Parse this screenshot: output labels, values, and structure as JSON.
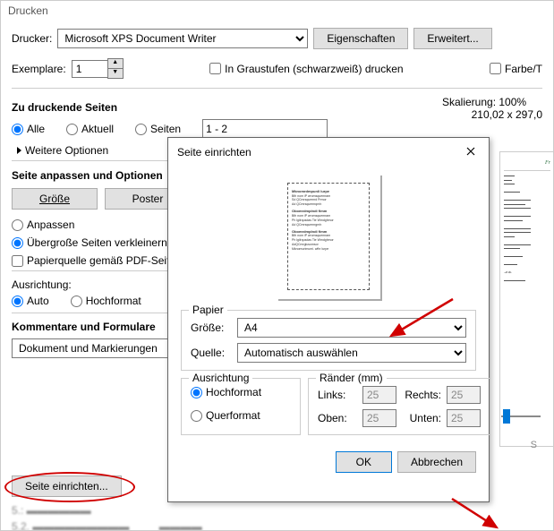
{
  "window": {
    "title": "Drucken"
  },
  "printer": {
    "label": "Drucker:",
    "value": "Microsoft XPS Document Writer",
    "properties_btn": "Eigenschaften",
    "advanced_btn": "Erweitert..."
  },
  "copies": {
    "label": "Exemplare:",
    "value": "1"
  },
  "grayscale": {
    "label": "In Graustufen (schwarzweiß) drucken"
  },
  "color": {
    "label": "Farbe/T"
  },
  "pages_section": {
    "title": "Zu druckende Seiten",
    "all": "Alle",
    "current": "Aktuell",
    "pages": "Seiten",
    "range_value": "1 - 2",
    "more": "Weitere Optionen"
  },
  "fit_section": {
    "title": "Seite anpassen und Optionen",
    "size_btn": "Größe",
    "poster_btn": "Poster",
    "fit": "Anpassen",
    "shrink": "Übergroße Seiten verkleinern",
    "paper_source": "Papierquelle gemäß PDF-Seit"
  },
  "orientation_section": {
    "title": "Ausrichtung:",
    "auto": "Auto",
    "portrait": "Hochformat"
  },
  "comments_section": {
    "title": "Kommentare und Formulare",
    "value": "Dokument und Markierungen"
  },
  "page_setup_btn": "Seite einrichten...",
  "scaling": {
    "label": "Skalierung: 100%",
    "dimensions": "210,02 x 297,0"
  },
  "modal": {
    "title": "Seite einrichten",
    "paper": {
      "legend": "Papier",
      "size_label": "Größe:",
      "size_value": "A4",
      "source_label": "Quelle:",
      "source_value": "Automatisch auswählen"
    },
    "orientation": {
      "legend": "Ausrichtung",
      "portrait": "Hochformat",
      "landscape": "Querformat"
    },
    "margins": {
      "legend": "Ränder (mm)",
      "left_label": "Links:",
      "left_value": "25",
      "right_label": "Rechts:",
      "right_value": "25",
      "top_label": "Oben:",
      "top_value": "25",
      "bottom_label": "Unten:",
      "bottom_value": "25"
    },
    "ok_btn": "OK",
    "cancel_btn": "Abbrechen"
  },
  "doc_preview_title": "Fr"
}
